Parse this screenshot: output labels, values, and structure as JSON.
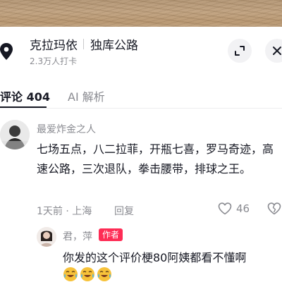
{
  "location": {
    "name": "克拉玛依",
    "route": "独库公路",
    "checkins": "2.3万人打卡"
  },
  "tabs": [
    {
      "label": "评论 404",
      "active": true
    },
    {
      "label": "AI 解析",
      "active": false
    }
  ],
  "comment": {
    "username": "最爱炸金之人",
    "text": "七场五点，八二拉菲，开瓶七喜，罗马奇迹，高速公路，三次退队，拳击腰带，排球之王。",
    "meta": "1天前 · 上海",
    "reply_label": "回复",
    "likes": "46"
  },
  "reply": {
    "username": "君，萍",
    "badge": "作者",
    "text": "你发的这个评价梗80阿姨都看不懂啊",
    "emojis": [
      "crying-laughing-emoji",
      "crying-laughing-emoji",
      "crying-laughing-emoji"
    ]
  },
  "colors": {
    "accent": "#fe2c55",
    "text_primary": "#161823",
    "text_secondary": "#8a8b91"
  }
}
